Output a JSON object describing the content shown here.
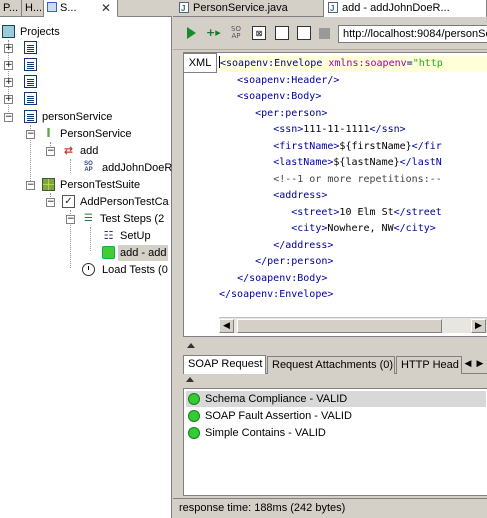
{
  "left_tabs": [
    {
      "label": "P..."
    },
    {
      "label": "H..."
    },
    {
      "label": "S..."
    }
  ],
  "tree": {
    "root_label": "Projects",
    "project_label": "personService",
    "interface_label": "PersonService",
    "operation_label": "add",
    "request_label": "addJohnDoeR",
    "testsuite_label": "PersonTestSuite",
    "testcase_label": "AddPersonTestCa",
    "teststeps_label": "Test Steps (2",
    "setup_label": "SetUp",
    "step_add_label": "add - add",
    "loadtests_label": "Load Tests (0"
  },
  "editor_tabs": [
    {
      "label": "PersonService.java"
    },
    {
      "label": "add - addJohnDoeR..."
    }
  ],
  "toolbar": {
    "endpoint_url": "http://localhost:9084/personSe"
  },
  "xml_editor": {
    "view_button": "XML",
    "lines": [
      {
        "indent": "",
        "parts": [
          [
            "tg",
            "<soapenv:Envelope "
          ],
          [
            "at",
            "xmlns:soapenv"
          ],
          [
            "tg",
            "="
          ],
          [
            "av",
            "\"http"
          ]
        ]
      },
      {
        "indent": "   ",
        "parts": [
          [
            "tg",
            "<soapenv:Header/>"
          ]
        ]
      },
      {
        "indent": "   ",
        "parts": [
          [
            "tg",
            "<soapenv:Body>"
          ]
        ]
      },
      {
        "indent": "      ",
        "parts": [
          [
            "tg",
            "<per:person>"
          ]
        ]
      },
      {
        "indent": "         ",
        "parts": [
          [
            "tg",
            "<ssn>"
          ],
          [
            "tx",
            "111-11-1111"
          ],
          [
            "tg",
            "</ssn>"
          ]
        ]
      },
      {
        "indent": "         ",
        "parts": [
          [
            "tg",
            "<firstName>"
          ],
          [
            "tx",
            "${firstName}"
          ],
          [
            "tg",
            "</fir"
          ]
        ]
      },
      {
        "indent": "         ",
        "parts": [
          [
            "tg",
            "<lastName>"
          ],
          [
            "tx",
            "${lastName}"
          ],
          [
            "tg",
            "</lastN"
          ]
        ]
      },
      {
        "indent": "         ",
        "parts": [
          [
            "cm",
            "<!--1 or more repetitions:--"
          ]
        ]
      },
      {
        "indent": "         ",
        "parts": [
          [
            "tg",
            "<address>"
          ]
        ]
      },
      {
        "indent": "            ",
        "parts": [
          [
            "tg",
            "<street>"
          ],
          [
            "tx",
            "10 Elm St"
          ],
          [
            "tg",
            "</street"
          ]
        ]
      },
      {
        "indent": "            ",
        "parts": [
          [
            "tg",
            "<city>"
          ],
          [
            "tx",
            "Nowhere, NW"
          ],
          [
            "tg",
            "</city>"
          ]
        ]
      },
      {
        "indent": "         ",
        "parts": [
          [
            "tg",
            "</address>"
          ]
        ]
      },
      {
        "indent": "      ",
        "parts": [
          [
            "tg",
            "</per:person>"
          ]
        ]
      },
      {
        "indent": "   ",
        "parts": [
          [
            "tg",
            "</soapenv:Body>"
          ]
        ]
      },
      {
        "indent": "",
        "parts": [
          [
            "tg",
            "</soapenv:Envelope>"
          ]
        ]
      }
    ]
  },
  "bottom_tabs": [
    {
      "label": "SOAP Request"
    },
    {
      "label": "Request Attachments (0)"
    },
    {
      "label": "HTTP Head"
    }
  ],
  "assertions": [
    {
      "label": "Schema Compliance - VALID",
      "status_color": "#33cc33"
    },
    {
      "label": "SOAP Fault Assertion - VALID",
      "status_color": "#33cc33"
    },
    {
      "label": "Simple Contains - VALID",
      "status_color": "#33cc33"
    }
  ],
  "status_bar": {
    "text": "response time: 188ms (242 bytes)"
  }
}
